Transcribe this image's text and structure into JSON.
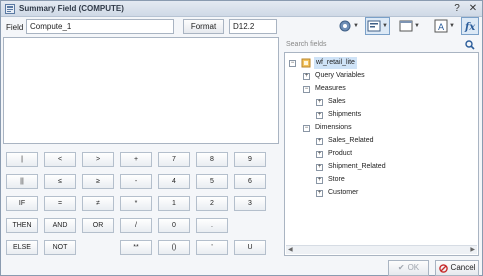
{
  "window": {
    "title": "Summary Field (COMPUTE)"
  },
  "field": {
    "label": "Field",
    "value": "Compute_1"
  },
  "format": {
    "button_label": "Format",
    "value": "D12.2"
  },
  "search": {
    "placeholder": "Search fields"
  },
  "keypad": {
    "rows": [
      [
        "|",
        "<",
        ">",
        "+",
        "7",
        "8",
        "9"
      ],
      [
        "||",
        "≤",
        "≥",
        "-",
        "4",
        "5",
        "6"
      ],
      [
        "IF",
        "=",
        "≠",
        "*",
        "1",
        "2",
        "3"
      ],
      [
        "THEN",
        "AND",
        "OR",
        "/",
        "0",
        "."
      ],
      [
        "ELSE",
        "NOT",
        "**",
        "()",
        "'",
        "U"
      ]
    ]
  },
  "tree": {
    "root": "wf_retail_lite",
    "items": [
      {
        "label": "Query Variables",
        "toggle": "+",
        "level": 1
      },
      {
        "label": "Measures",
        "toggle": "−",
        "level": 1
      },
      {
        "label": "Sales",
        "toggle": "+",
        "level": 2
      },
      {
        "label": "Shipments",
        "toggle": "+",
        "level": 2
      },
      {
        "label": "Dimensions",
        "toggle": "−",
        "level": 1
      },
      {
        "label": "Sales_Related",
        "toggle": "+",
        "level": 2
      },
      {
        "label": "Product",
        "toggle": "+",
        "level": 2
      },
      {
        "label": "Shipment_Related",
        "toggle": "+",
        "level": 2
      },
      {
        "label": "Store",
        "toggle": "+",
        "level": 2
      },
      {
        "label": "Customer",
        "toggle": "+",
        "level": 2
      }
    ]
  },
  "footer": {
    "ok_label": "OK",
    "cancel_label": "Cancel"
  },
  "colors": {
    "accent": "#2a5c9a",
    "title_bg": "#d8e1ec",
    "cancel_icon": "#c62828"
  },
  "icons": {
    "title": "settings-dialog-icon",
    "toolbar": [
      "gear-icon",
      "field-list-icon",
      "view-icon",
      "text-icon",
      "function-icon"
    ]
  }
}
